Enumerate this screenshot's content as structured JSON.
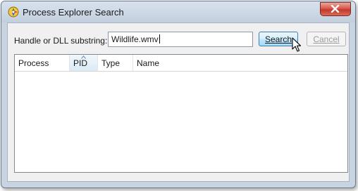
{
  "window": {
    "title": "Process Explorer Search"
  },
  "form": {
    "substring_label": "Handle or DLL substring:",
    "substring_value": "Wildlife.wmv",
    "search_label": "Search",
    "cancel_label": "Cancel"
  },
  "results": {
    "columns": [
      "Process",
      "PID",
      "Type",
      "Name"
    ],
    "sorted_column": "PID",
    "rows": []
  },
  "icons": {
    "app": "process-explorer-icon",
    "close": "close-icon",
    "cursor": "mouse-pointer-icon",
    "sort": "sort-ascending-icon"
  },
  "colors": {
    "close_button": "#c3392c",
    "search_button_border": "#3c7fb1",
    "title_bar": "#c3cfde"
  }
}
